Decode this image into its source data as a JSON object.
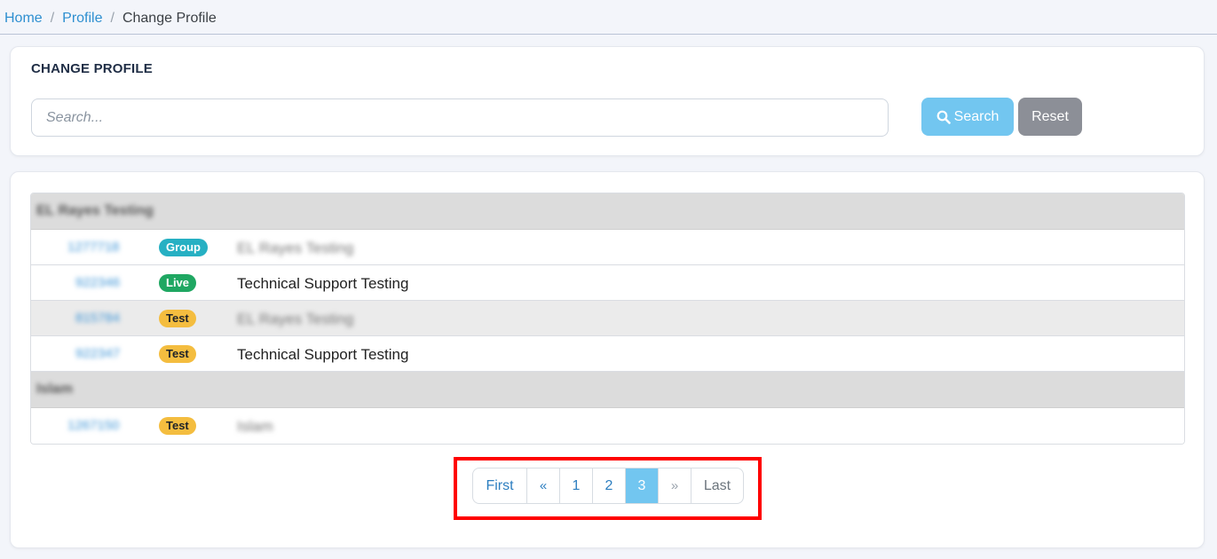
{
  "breadcrumb": {
    "home": "Home",
    "profile": "Profile",
    "current": "Change Profile",
    "separator": "/"
  },
  "header": {
    "title": "CHANGE PROFILE"
  },
  "search": {
    "placeholder": "Search...",
    "value": "",
    "search_label": "Search",
    "reset_label": "Reset"
  },
  "groups": [
    {
      "name": "EL Rayes Testing",
      "rows": [
        {
          "id": "1277718",
          "badge": "Group",
          "name": "EL Rayes Testing"
        },
        {
          "id": "922346",
          "badge": "Live",
          "name": "Technical Support Testing"
        },
        {
          "id": "815784",
          "badge": "Test",
          "name": "EL Rayes Testing"
        },
        {
          "id": "922347",
          "badge": "Test",
          "name": "Technical Support Testing"
        }
      ]
    },
    {
      "name": "Islam",
      "rows": [
        {
          "id": "1267150",
          "badge": "Test",
          "name": "Islam"
        }
      ]
    }
  ],
  "pagination": {
    "first": "First",
    "prev": "«",
    "pages": [
      "1",
      "2",
      "3"
    ],
    "active_page": "3",
    "next": "»",
    "last": "Last"
  },
  "colors": {
    "link": "#2e8fd0",
    "search_button": "#72c6f0",
    "reset_button": "#8c8f97",
    "badge_group": "#26b0c3",
    "badge_live": "#1fa762",
    "badge_test": "#f4bd3f",
    "highlight": "#ff0000"
  }
}
